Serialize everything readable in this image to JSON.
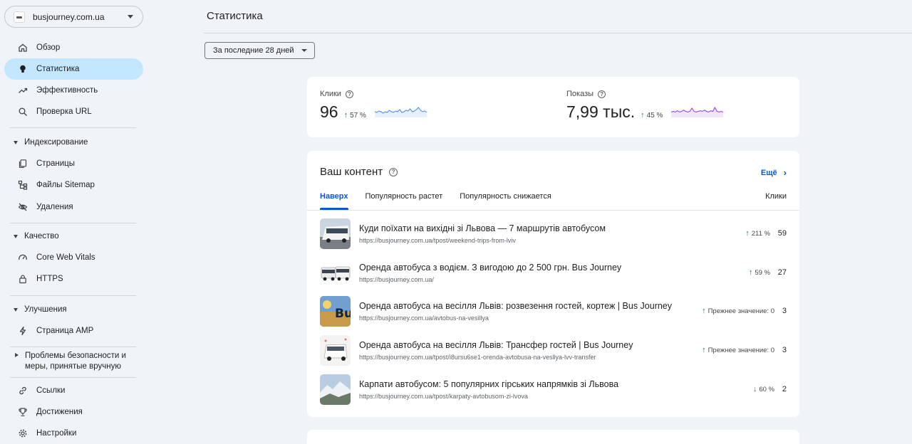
{
  "property": {
    "name": "busjourney.com.ua"
  },
  "nav": {
    "overview": "Обзор",
    "insights": "Статистика",
    "performance": "Эффективность",
    "url_inspection": "Проверка URL",
    "indexing": {
      "header": "Индексирование",
      "pages": "Страницы",
      "sitemaps": "Файлы Sitemap",
      "removals": "Удаления"
    },
    "experience": {
      "header": "Качество",
      "cwv": "Core Web Vitals",
      "https": "HTTPS"
    },
    "enhancements": {
      "header": "Улучшения",
      "amp": "Страница AMP"
    },
    "security": {
      "header_line1": "Проблемы безопасности и",
      "header_line2": "меры, принятые вручную"
    },
    "links": "Ссылки",
    "achievements": "Достижения",
    "settings": "Настройки"
  },
  "page": {
    "title": "Статистика",
    "date_filter": "За последние 28 дней"
  },
  "metrics": {
    "clicks": {
      "label": "Клики",
      "value": "96",
      "delta": "57 %",
      "trend": [
        6,
        5,
        7,
        6,
        4,
        6,
        5,
        8,
        6,
        5,
        7,
        6,
        9,
        5,
        6,
        8,
        7,
        10,
        6,
        7,
        9,
        12,
        8,
        6,
        7,
        5
      ],
      "color": "#4285f4"
    },
    "impressions": {
      "label": "Показы",
      "value": "7,99 тыс.",
      "delta": "45 %",
      "trend": [
        6,
        7,
        6,
        8,
        6,
        7,
        9,
        7,
        6,
        7,
        12,
        7,
        6,
        7,
        8,
        7,
        9,
        7,
        6,
        8,
        7,
        13,
        7,
        6,
        7,
        6
      ],
      "color": "#9334e6"
    }
  },
  "content": {
    "title": "Ваш контент",
    "more": "Ещё",
    "tabs": [
      "Наверх",
      "Популярность растет",
      "Популярность снижается"
    ],
    "clicks_header": "Клики",
    "rows": [
      {
        "title": "Куди поїхати на вихідні зі Львова — 7 маршрутів автобусом",
        "url": "https://busjourney.com.ua/tpost/weekend-trips-from-lviv",
        "direction": "up",
        "change": "211 %",
        "clicks": "59"
      },
      {
        "title": "Оренда автобуса з водієм. З вигодою до 2 500 грн. Bus Journey",
        "url": "https://busjourney.com.ua/",
        "direction": "up",
        "change": "59 %",
        "clicks": "27"
      },
      {
        "title": "Оренда автобуса на весілля Львів: розвезення гостей, кортеж | Bus Journey",
        "url": "https://busjourney.com.ua/avtobus-na-vesillya",
        "direction": "up",
        "change": "Прежнее значение: 0",
        "clicks": "3"
      },
      {
        "title": "Оренда автобуса на весілля Львів: Трансфер гостей | Bus Journey",
        "url": "https://busjourney.com.ua/tpost/i8ursu6se1-orenda-avtobusa-na-vesllya-lvv-transfer",
        "direction": "up",
        "change": "Прежнее значение: 0",
        "clicks": "3"
      },
      {
        "title": "Карпати автобусом: 5 популярних гірських напрямків зі Львова",
        "url": "https://busjourney.com.ua/tpost/karpaty-avtobusom-zi-lvova",
        "direction": "down",
        "change": "60 %",
        "clicks": "2"
      }
    ]
  },
  "colors": {
    "accent": "#0b57d0",
    "active_nav": "#c2e7ff",
    "background": "#f0f4f9",
    "up": "#188038",
    "down": "#d93025"
  }
}
